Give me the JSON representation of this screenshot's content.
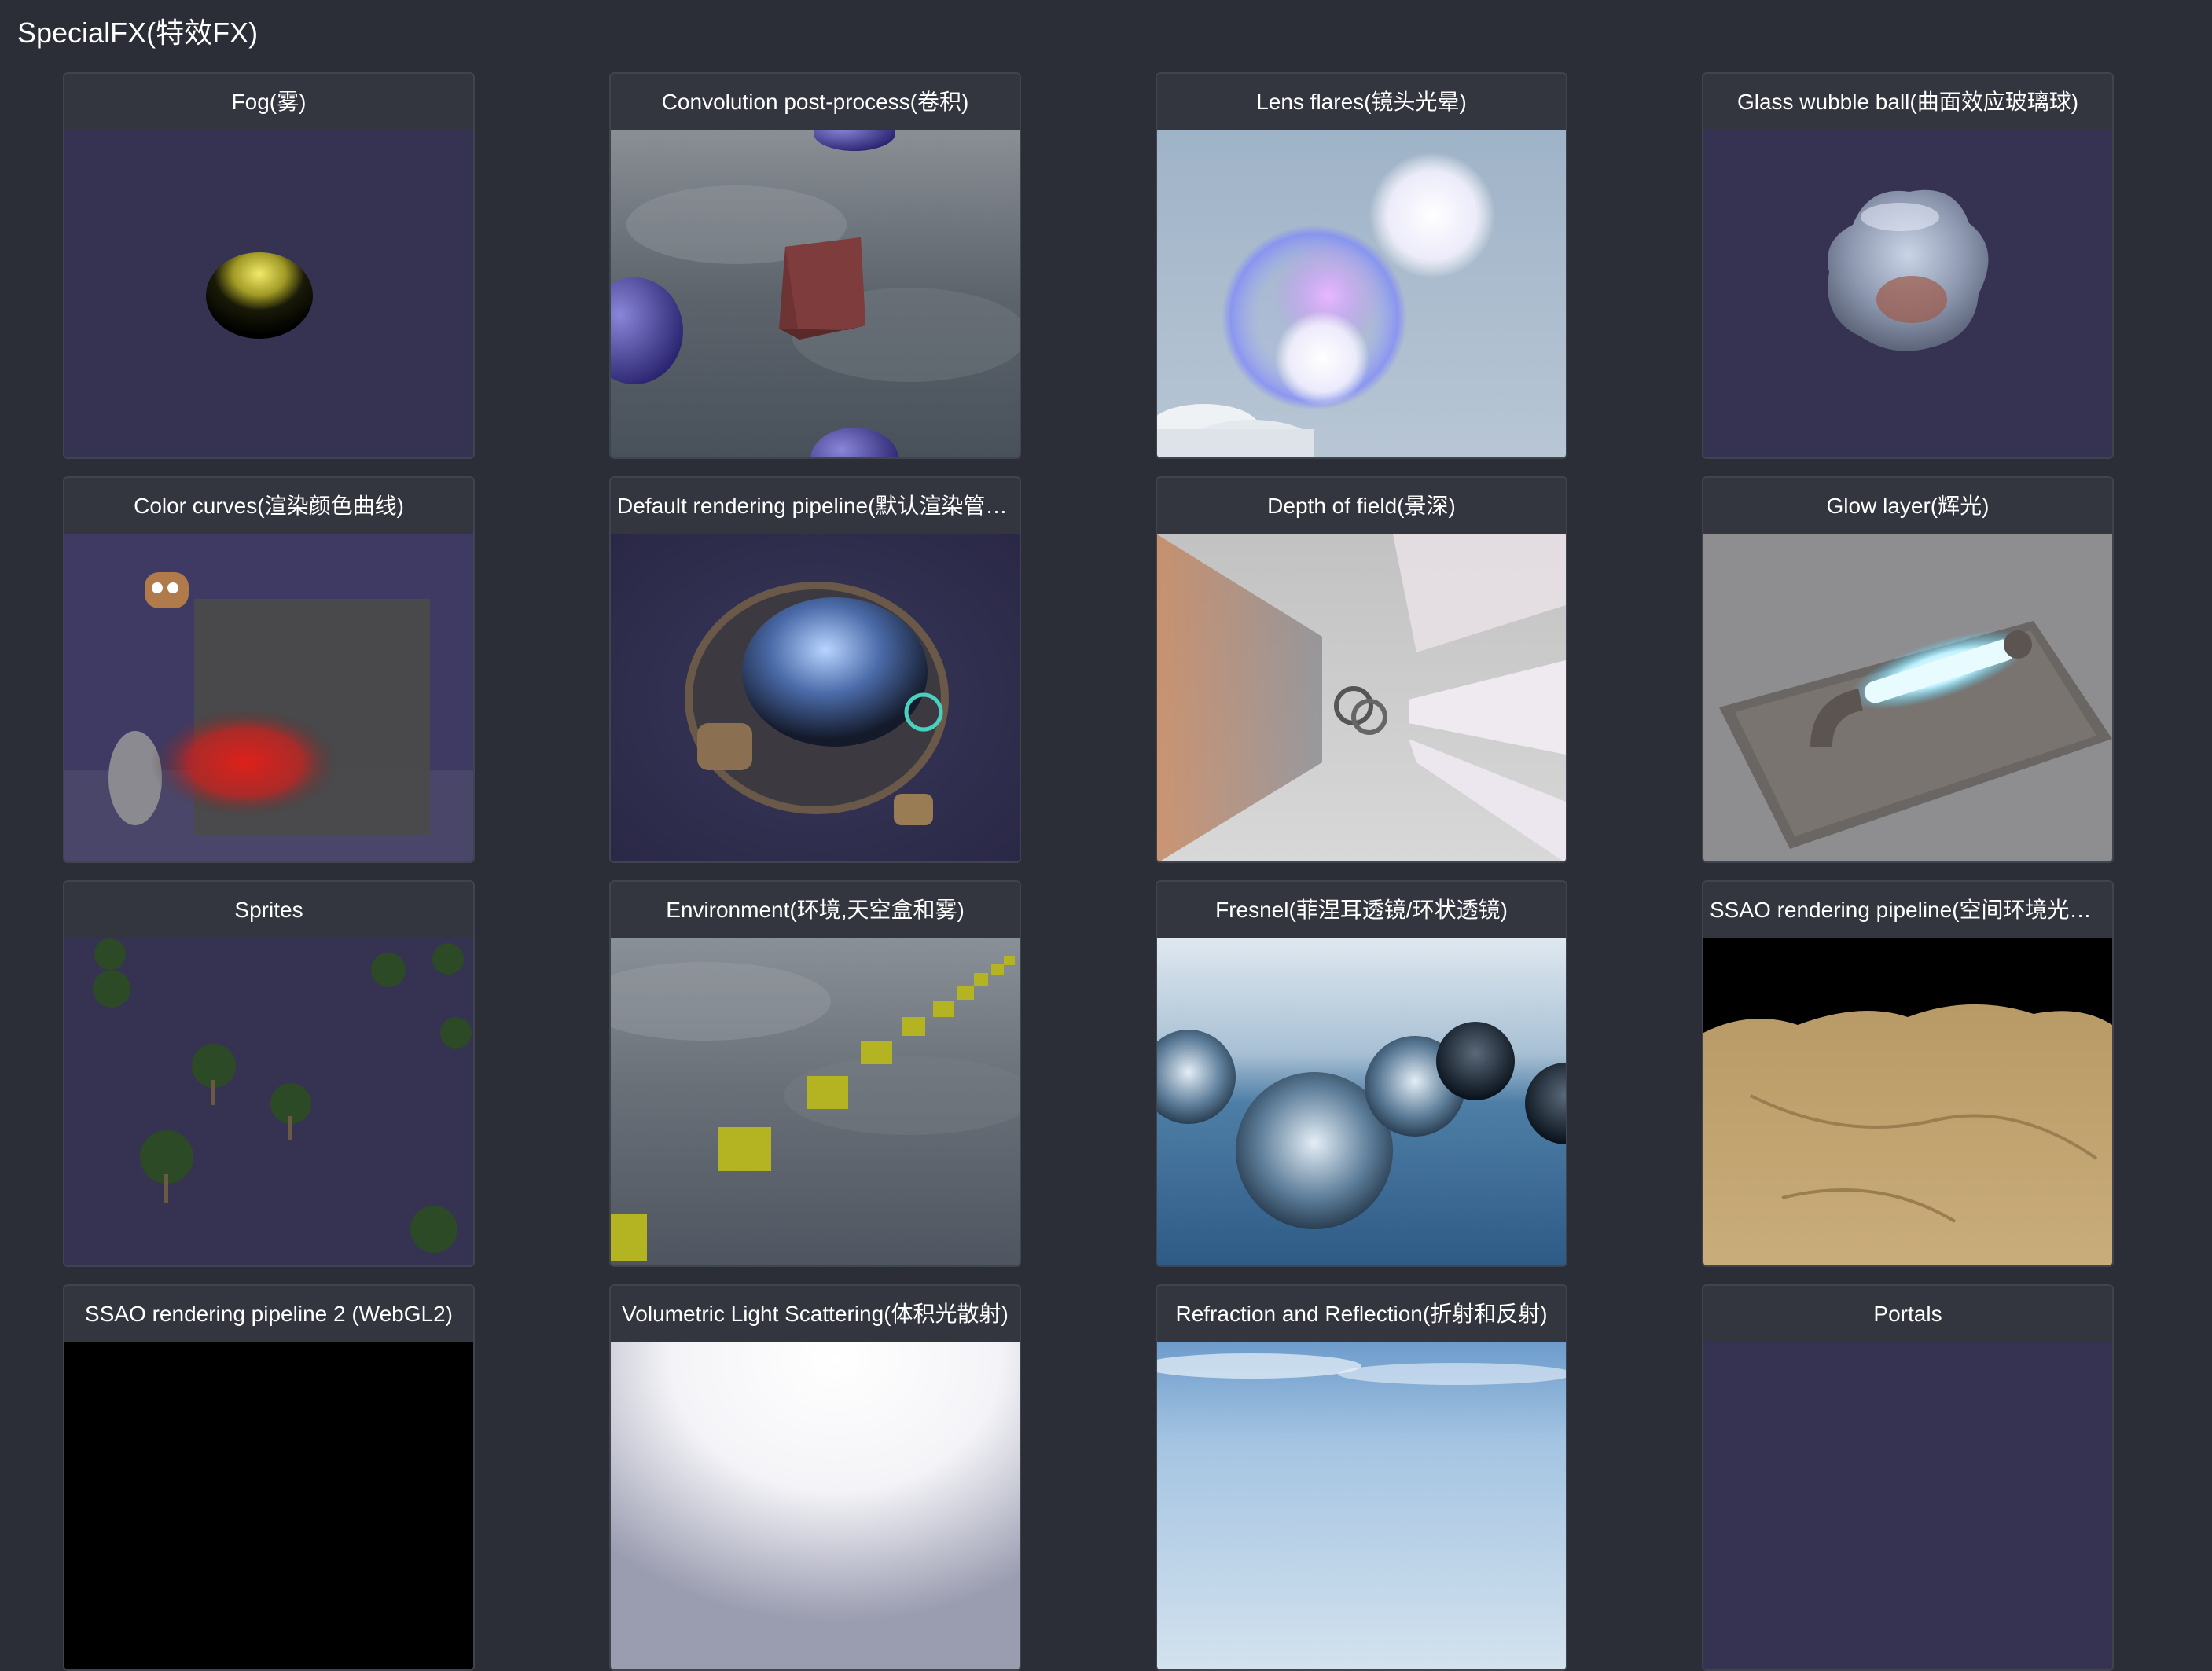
{
  "section": {
    "title": "SpecialFX(特效FX)"
  },
  "cards": [
    {
      "title": "Fog(雾)",
      "thumb": "fog-sphere"
    },
    {
      "title": "Convolution post-process(卷积)",
      "thumb": "convolution-scene"
    },
    {
      "title": "Lens flares(镜头光晕)",
      "thumb": "lens-flares-scene"
    },
    {
      "title": "Glass wubble ball(曲面效应玻璃球)",
      "thumb": "glass-ball"
    },
    {
      "title": "Color curves(渲染颜色曲线)",
      "thumb": "color-curves-scene"
    },
    {
      "title": "Default rendering pipeline(默认渲染管线)",
      "thumb": "helmet-model"
    },
    {
      "title": "Depth of field(景深)",
      "thumb": "depth-of-field-scene"
    },
    {
      "title": "Glow layer(辉光)",
      "thumb": "glow-tube"
    },
    {
      "title": "Sprites",
      "thumb": "tree-sprites"
    },
    {
      "title": "Environment(环境,天空盒和雾)",
      "thumb": "skybox-cubes"
    },
    {
      "title": "Fresnel(菲涅耳透镜/环状透镜)",
      "thumb": "fresnel-spheres"
    },
    {
      "title": "SSAO rendering pipeline(空间环境光遮...",
      "thumb": "ssao-terrain"
    },
    {
      "title": "SSAO rendering pipeline 2 (WebGL2)",
      "thumb": "ssao2-dark"
    },
    {
      "title": "Volumetric Light Scattering(体积光散射)",
      "thumb": "volumetric-light"
    },
    {
      "title": "Refraction and Reflection(折射和反射)",
      "thumb": "refraction-sky"
    },
    {
      "title": "Portals",
      "thumb": "portals-scene"
    }
  ]
}
